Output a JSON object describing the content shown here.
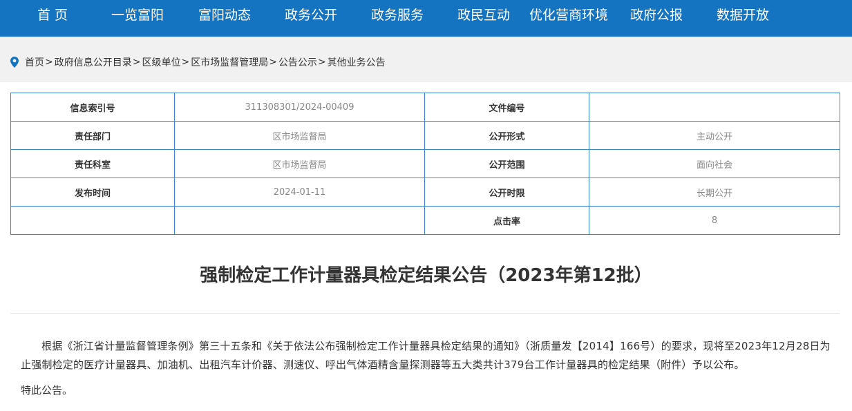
{
  "nav": {
    "items": [
      "首 页",
      "一览富阳",
      "富阳动态",
      "政务公开",
      "政务服务",
      "政民互动",
      "优化营商环境",
      "政府公报",
      "数据开放"
    ]
  },
  "breadcrumb": {
    "items": [
      "首页",
      "政府信息公开目录",
      "区级单位",
      "区市场监督管理局",
      "公告公示",
      "其他业务公告"
    ],
    "separator": ">"
  },
  "meta": {
    "index_label": "信息索引号",
    "index_value": "311308301/2024-00409",
    "doc_no_label": "文件编号",
    "doc_no_value": "",
    "dept_label": "责任部门",
    "dept_value": "区市场监督局",
    "form_label": "公开形式",
    "form_value": "主动公开",
    "office_label": "责任科室",
    "office_value": "区市场监督局",
    "scope_label": "公开范围",
    "scope_value": "面向社会",
    "date_label": "发布时间",
    "date_value": "2024-01-11",
    "term_label": "公开时限",
    "term_value": "长期公开",
    "clicks_label": "点击率",
    "clicks_value": "8"
  },
  "article": {
    "title": "强制检定工作计量器具检定结果公告（2023年第12批）",
    "paragraph": "根据《浙江省计量监督管理条例》第三十五条和《关于依法公布强制检定工作计量器具检定结果的通知》（浙质量发【2014】166号）的要求，现将至2023年12月28日为止强制检定的医疗计量器具、加油机、出租汽车计价器、测速仪、呼出气体酒精含量探测器等五大类共计379台工作计量器具的检定结果（附件）予以公布。",
    "closing": "特此公告。"
  },
  "colors": {
    "nav_bg": "#1574c2",
    "table_border": "#3a86c6",
    "crumb_bg": "#f1f1f1"
  },
  "icons": {
    "breadcrumb": "location-pin-icon"
  }
}
